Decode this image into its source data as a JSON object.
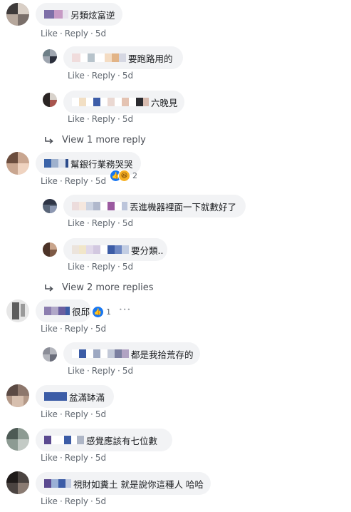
{
  "labels": {
    "like": "Like",
    "reply": "Reply",
    "sep": "·"
  },
  "comments": [
    {
      "text": "另類炫富逆",
      "time": "5d"
    },
    {
      "text": "要跑路用的",
      "time": "5d"
    },
    {
      "text": "六晚見",
      "time": "5d"
    },
    {
      "text": "View 1 more reply"
    },
    {
      "text": "幫銀行業務哭哭",
      "time": "5d",
      "reactions": "2"
    },
    {
      "text": "丟進機器裡面一下就數好了",
      "time": "5d"
    },
    {
      "text": "要分類..",
      "time": "5d"
    },
    {
      "text": "View 2 more replies"
    },
    {
      "text": "很邱",
      "time": "5d",
      "reactions": "1",
      "more": "•••"
    },
    {
      "text": "都是我拾荒存的",
      "time": "5d"
    },
    {
      "text": "盆滿缽滿",
      "time": "5d"
    },
    {
      "text": "感覺應該有七位數",
      "time": "5d"
    },
    {
      "text": "視財如糞土 就是說你這種人 哈哈",
      "time": "5d"
    }
  ],
  "icons": {
    "reply_arrow": "reply-arrow-icon",
    "like_reaction": "like-reaction-icon",
    "haha_reaction": "haha-reaction-icon",
    "more": "more-options-icon"
  },
  "colors": {
    "bubble": "#f2f3f5",
    "meta": "#606770",
    "like": "#1877f2",
    "haha": "#f7b125"
  }
}
